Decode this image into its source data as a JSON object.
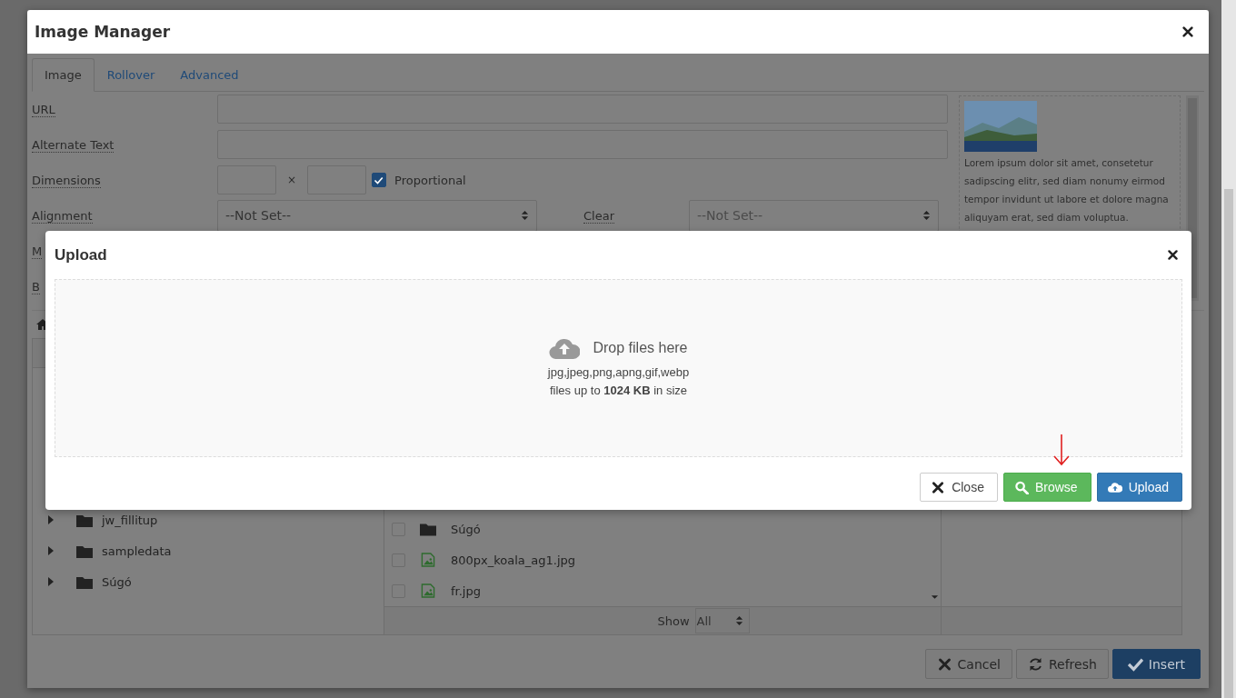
{
  "image_manager": {
    "title": "Image Manager",
    "tabs": [
      {
        "label": "Image",
        "selected": true
      },
      {
        "label": "Rollover",
        "selected": false
      },
      {
        "label": "Advanced",
        "selected": false
      }
    ],
    "form": {
      "url": {
        "label": "URL"
      },
      "alt": {
        "label": "Alternate Text"
      },
      "dimensions": {
        "label": "Dimensions",
        "separator": "×",
        "proportional": {
          "label": "Proportional",
          "checked": true
        }
      },
      "alignment": {
        "label": "Alignment",
        "value": "--Not Set--"
      },
      "clear": {
        "label": "Clear",
        "value": "--Not Set--"
      },
      "row_5": {
        "label": "M"
      },
      "row_6": {
        "label": "B"
      }
    },
    "preview": {
      "text": "Lorem ipsum dolor sit amet, consetetur sadipscing elitr, sed diam nonumy eirmod tempor invidunt ut labore et dolore magna aliquyam erat, sed diam voluptua."
    },
    "folder_tree": [
      {
        "name": "jw_fillitup",
        "expanded": false
      },
      {
        "name": "sampledata",
        "expanded": false
      },
      {
        "name": "Súgó",
        "expanded": false
      }
    ],
    "files": [
      {
        "name": "Súgó",
        "kind": "folder",
        "checked": false
      },
      {
        "name": "800px_koala_ag1.jpg",
        "kind": "image",
        "checked": false
      },
      {
        "name": "fr.jpg",
        "kind": "image",
        "checked": false
      }
    ],
    "show": {
      "label": "Show",
      "value": "All"
    },
    "buttons": [
      {
        "label": "Cancel",
        "kind": "cancel"
      },
      {
        "label": "Refresh",
        "kind": "refresh"
      },
      {
        "label": "Insert",
        "kind": "insert"
      }
    ]
  },
  "upload": {
    "title": "Upload",
    "drop_text": "Drop files here",
    "types": "jpg,jpeg,png,apng,gif,webp",
    "limit": "files up to **1024 KB** in size",
    "buttons": [
      {
        "label": "Close",
        "kind": "close"
      },
      {
        "label": "Browse",
        "kind": "browse"
      },
      {
        "label": "Upload",
        "kind": "upload"
      }
    ]
  }
}
